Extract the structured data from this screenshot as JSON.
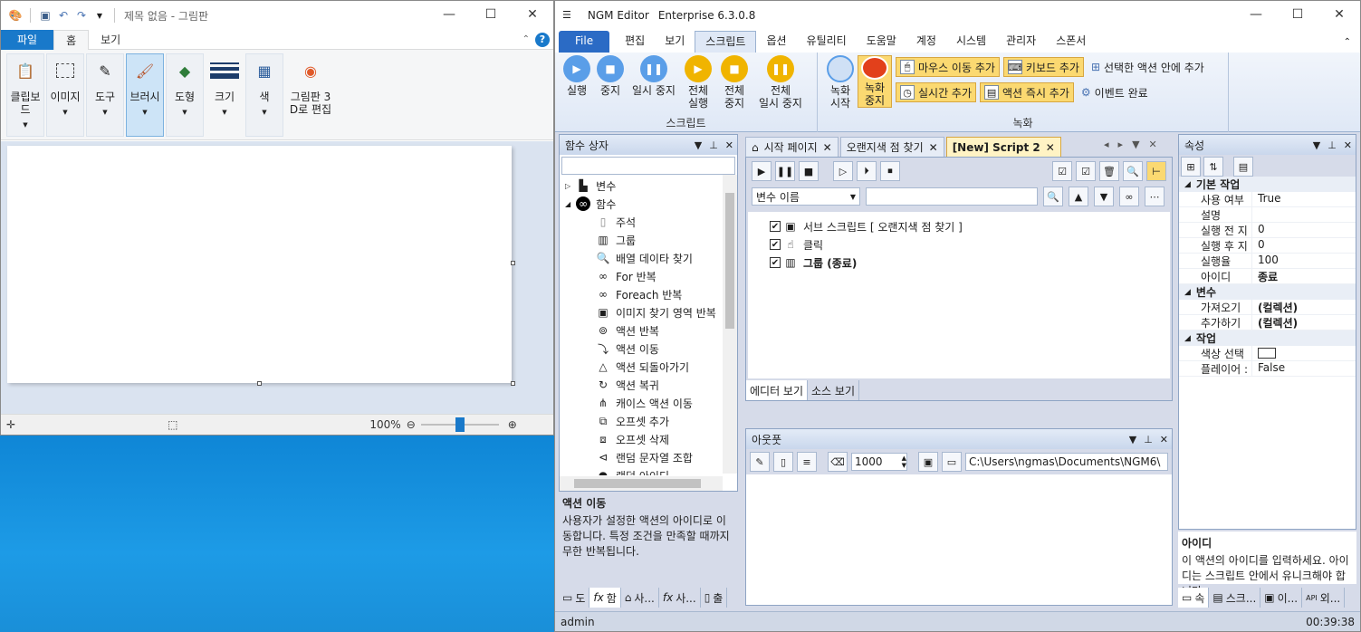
{
  "paint": {
    "title": "제목 없음 - 그림판",
    "tabs": {
      "file": "파일",
      "home": "홈",
      "view": "보기"
    },
    "ribbon": {
      "clipboard": "클립보드",
      "image": "이미지",
      "tools": "도구",
      "brushes": "브러시",
      "shapes": "도형",
      "size": "크기",
      "colors": "색",
      "paint3d_1": "그림판 3",
      "paint3d_2": "D로 편집"
    },
    "status": {
      "zoom": "100%"
    }
  },
  "ngm": {
    "title": "NGM Editor",
    "edition": "Enterprise 6.3.0.8",
    "menu": [
      "File",
      "편집",
      "보기",
      "스크립트",
      "옵션",
      "유틸리티",
      "도움말",
      "계정",
      "시스템",
      "관리자",
      "스폰서"
    ],
    "ribbon": {
      "run": "실행",
      "stop": "중지",
      "pause": "일시 중지",
      "all_run_1": "전체",
      "all_run_2": "실행",
      "all_stop_1": "전체",
      "all_stop_2": "중지",
      "all_pause_1": "전체",
      "all_pause_2": "일시 중지",
      "script_group": "스크립트",
      "rec_start_1": "녹화",
      "rec_start_2": "시작",
      "rec_stop_1": "녹화",
      "rec_stop_2": "중지",
      "mouse_move": "마우스 이동 추가",
      "keyboard": "키보드 추가",
      "add_in_selected": "선택한 액션 안에 추가",
      "realtime": "실시간 추가",
      "action_now": "액션 즉시 추가",
      "event_done": "이벤트 완료",
      "rec_group": "녹화"
    },
    "func_box": {
      "title": "함수 상자",
      "items": [
        "변수",
        "함수",
        "주석",
        "그룹",
        "배열 데이타 찾기",
        "For 반복",
        "Foreach 반복",
        "이미지 찾기 영역 반복",
        "액션 반복",
        "액션 이동",
        "액션 되돌아가기",
        "액션 복귀",
        "캐이스 액션 이동",
        "오프셋 추가",
        "오프셋 삭제",
        "랜덤 문자열 조합",
        "랜덤 아이디"
      ],
      "desc_title": "액션 이동",
      "desc_text": "사용자가 설정한 액션의 아이디로 이동합니다. 특정 조건을 만족할 때까지 무한 반복됩니다.",
      "bottom_tabs": [
        "도",
        "함",
        "사...",
        "사...",
        "출"
      ]
    },
    "editor": {
      "tabs": [
        "시작 페이지",
        "오랜지색 점 찾기",
        "[New] Script 2"
      ],
      "var_select": "변수 이름",
      "rows": [
        "서브 스크립트 [ 오랜지색 점 찾기 ]",
        "클릭",
        "그룹 (종료)"
      ],
      "view_tabs": [
        "에디터 보기",
        "소스 보기"
      ]
    },
    "output": {
      "title": "아웃풋",
      "count": "1000",
      "path": "C:\\Users\\ngmas\\Documents\\NGM6\\"
    },
    "props": {
      "title": "속성",
      "cat1": "기본 작업",
      "rows1": [
        [
          "사용 여부",
          "True"
        ],
        [
          "설명",
          ""
        ],
        [
          "실행 전 지",
          "0"
        ],
        [
          "실행 후 지",
          "0"
        ],
        [
          "실행율",
          "100"
        ],
        [
          "아이디",
          "종료"
        ]
      ],
      "cat2": "변수",
      "rows2": [
        [
          "가져오기",
          "(컬렉션)"
        ],
        [
          "추가하기",
          "(컬렉션)"
        ]
      ],
      "cat3": "작업",
      "rows3": [
        [
          "색상 선택",
          ""
        ],
        [
          "플레이어 :",
          "False"
        ]
      ],
      "desc_title": "아이디",
      "desc_text": "이 액션의 아이디를 입력하세요. 아이디는 스크립트 안에서 유니크해야 합니다.",
      "bottom_tabs": [
        "속",
        "스크...",
        "이...",
        "외..."
      ]
    },
    "status": {
      "user": "admin",
      "time": "00:39:38"
    }
  }
}
